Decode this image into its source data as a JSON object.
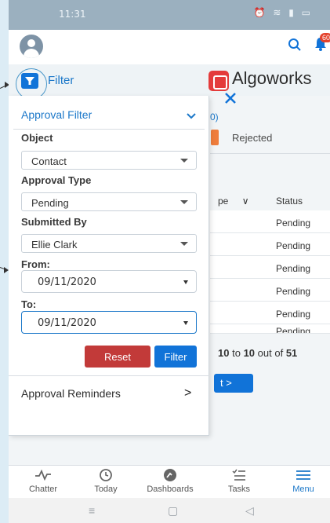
{
  "status_bar": {
    "time": "11:31",
    "icons": "⏰ ≋ ▮ ▭"
  },
  "header": {
    "notification_count": "60"
  },
  "filter_row": {
    "label": "Filter",
    "logo_text": "Algoworks"
  },
  "panel": {
    "title": "Approval Filter",
    "object_label": "Object",
    "object_value": "Contact",
    "approval_type_label": "Approval Type",
    "approval_type_value": "Pending",
    "submitted_by_label": "Submitted By",
    "submitted_by_value": "Ellie Clark",
    "from_label": "From:",
    "from_value": "09/11/2020",
    "to_label": "To:",
    "to_value": "09/11/2020",
    "reset_label": "Reset",
    "filter_label": "Filter",
    "reminders_label": "Approval Reminders",
    "reminders_chevron": ">"
  },
  "background": {
    "tab_count": "0)",
    "rejected_label": "Rejected",
    "col_type": "pe",
    "col_status": "Status",
    "rows": [
      "Pending",
      "Pending",
      "Pending",
      "Pending",
      "Pending",
      "Pending"
    ],
    "pagination_prefix": "10",
    "pagination_to": "to",
    "pagination_end": "10",
    "pagination_out": "out of",
    "pagination_total": "51",
    "next_label": "t >"
  },
  "bottom_nav": {
    "items": [
      {
        "label": "Chatter",
        "icon": "chatter-icon"
      },
      {
        "label": "Today",
        "icon": "clock-icon"
      },
      {
        "label": "Dashboards",
        "icon": "gauge-icon"
      },
      {
        "label": "Tasks",
        "icon": "tasks-icon"
      },
      {
        "label": "Menu",
        "icon": "menu-icon"
      }
    ]
  },
  "colors": {
    "accent": "#1173d8",
    "reset": "#c23a39",
    "rejected": "#ef7d3c"
  }
}
